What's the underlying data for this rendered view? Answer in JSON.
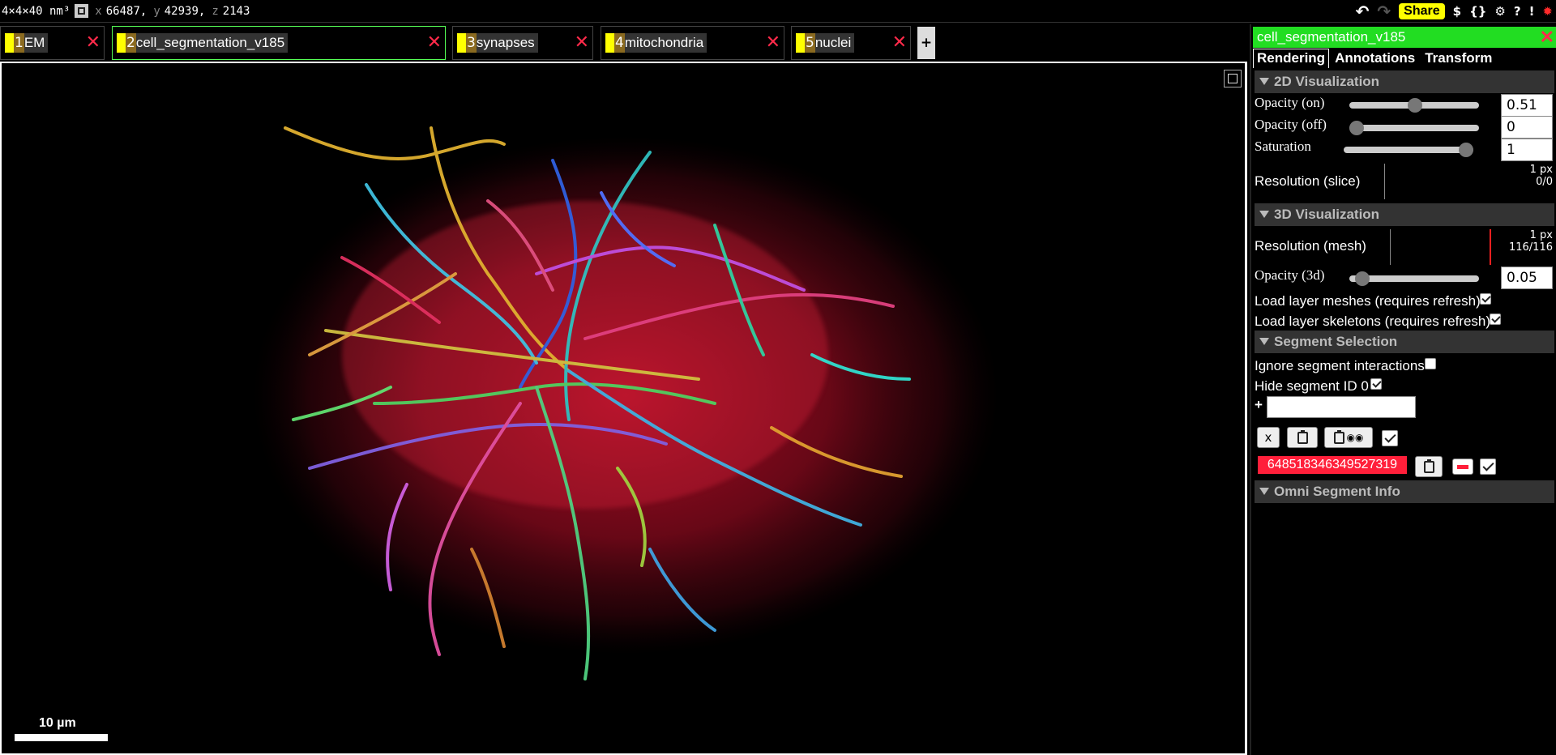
{
  "topbar": {
    "voxel_size": "4×4×40 nm³",
    "coords": [
      {
        "axis": "x",
        "value": "66487,"
      },
      {
        "axis": "y",
        "value": "42939,"
      },
      {
        "axis": "z",
        "value": "2143"
      }
    ],
    "share_label": "Share",
    "icons": [
      "undo-icon",
      "redo-icon",
      "dollar-icon",
      "json-icon",
      "gear-icon",
      "help-icon",
      "alert-icon",
      "bug-icon"
    ],
    "dollar": "$",
    "json": "{}",
    "gear": "⚙",
    "help": "?",
    "alert": "!",
    "bug": "🐞"
  },
  "layers": [
    {
      "num": "1",
      "name": "EM"
    },
    {
      "num": "2",
      "name": "cell_segmentation_v185"
    },
    {
      "num": "3",
      "name": "synapses"
    },
    {
      "num": "4",
      "name": "mitochondria"
    },
    {
      "num": "5",
      "name": "nuclei"
    }
  ],
  "add_layer": "+",
  "viewer": {
    "scale_label": "10 µm"
  },
  "panel": {
    "title": "cell_segmentation_v185",
    "tabs": [
      "Rendering",
      "Annotations",
      "Transform"
    ],
    "selected_tab": "Rendering",
    "sections": {
      "vis2d": "2D Visualization",
      "vis3d": "3D Visualization",
      "segsel": "Segment Selection",
      "omni": "Omni Segment Info"
    },
    "opacity_on": {
      "label": "Opacity (on)",
      "value": "0.51",
      "fraction": 0.51
    },
    "opacity_off": {
      "label": "Opacity (off)",
      "value": "0",
      "fraction": 0
    },
    "saturation": {
      "label": "Saturation",
      "value": "1",
      "fraction": 1
    },
    "res_slice": {
      "label": "Resolution (slice)",
      "px": "1 px",
      "count": "0/0"
    },
    "res_mesh": {
      "label": "Resolution (mesh)",
      "px": "1 px",
      "count": "116/116"
    },
    "opacity_3d": {
      "label": "Opacity (3d)",
      "value": "0.05",
      "fraction": 0.05
    },
    "load_meshes": {
      "label": "Load layer meshes (requires refresh)",
      "checked": true
    },
    "load_skeletons": {
      "label": "Load layer skeletons (requires refresh)",
      "checked": true
    },
    "ignore_interactions": {
      "label": "Ignore segment interactions",
      "checked": false
    },
    "hide_seg0": {
      "label": "Hide segment ID 0",
      "checked": true
    },
    "plus": "+",
    "clear_label": "x",
    "segment_id": "648518346349527319",
    "segment_color": "#ff1f3a"
  }
}
